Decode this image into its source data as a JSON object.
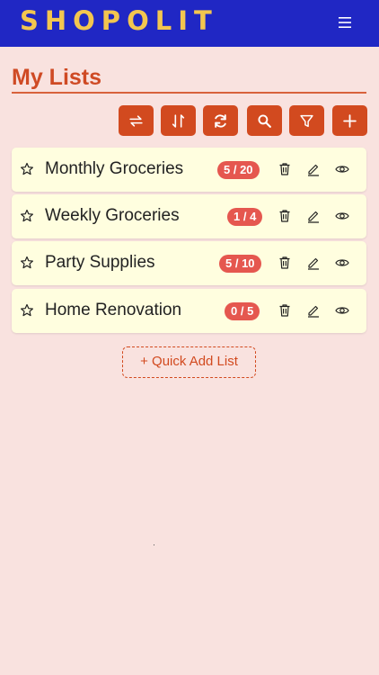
{
  "app": {
    "brand": "SHOPOLIT",
    "menu_icon": "hamburger-icon"
  },
  "page": {
    "title": "My Lists"
  },
  "toolbar": {
    "buttons": [
      {
        "icon": "swap-icon",
        "name": "swap-button"
      },
      {
        "icon": "sort-icon",
        "name": "sort-button"
      },
      {
        "icon": "refresh-icon",
        "name": "refresh-button"
      },
      {
        "icon": "search-icon",
        "name": "search-button"
      },
      {
        "icon": "filter-icon",
        "name": "filter-button"
      },
      {
        "icon": "plus-icon",
        "name": "add-list-button"
      }
    ]
  },
  "lists": [
    {
      "name": "Monthly Groceries",
      "progress": "5 / 20",
      "done": 5,
      "total": 20
    },
    {
      "name": "Weekly Groceries",
      "progress": "1 / 4",
      "done": 1,
      "total": 4
    },
    {
      "name": "Party Supplies",
      "progress": "5 / 10",
      "done": 5,
      "total": 10
    },
    {
      "name": "Home Renovation",
      "progress": "0 / 5",
      "done": 0,
      "total": 5
    }
  ],
  "quick_add": {
    "label": "+ Quick Add List"
  },
  "colors": {
    "header_bg": "#2027c4",
    "brand": "#f3c64f",
    "accent": "#d24a1f",
    "badge": "#e5574f",
    "card_bg": "#fffedf",
    "page_bg": "#f9e2df"
  }
}
